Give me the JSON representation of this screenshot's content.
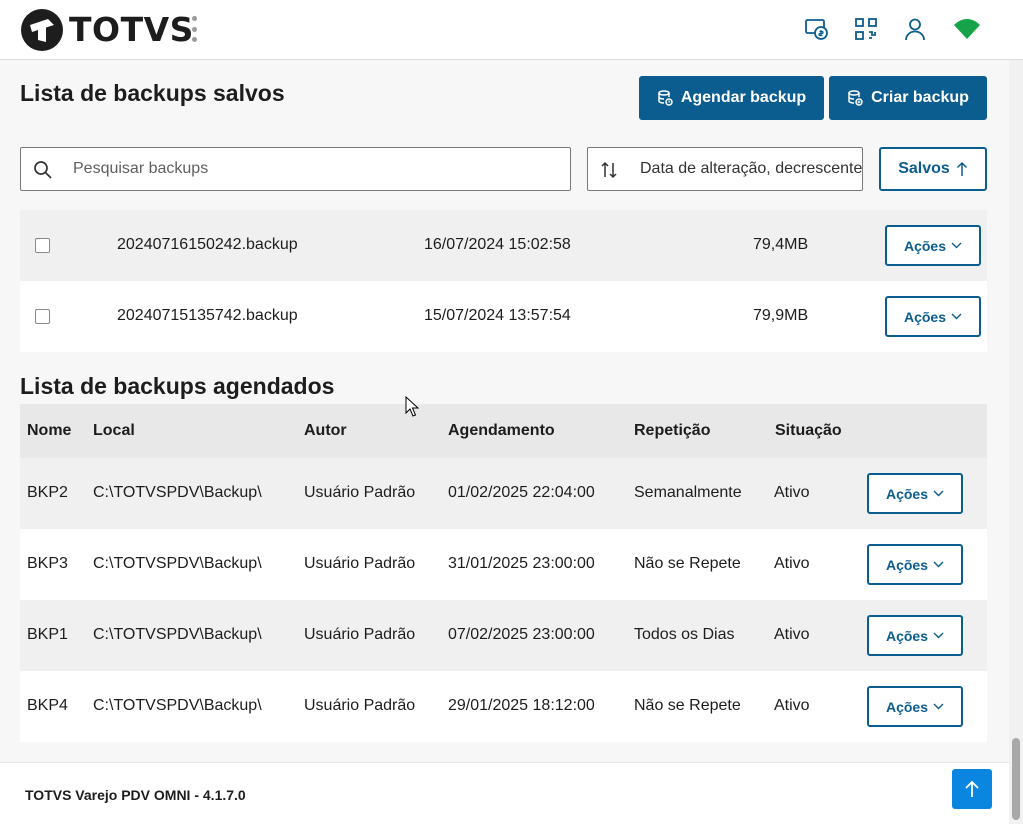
{
  "header": {
    "brand": "TOTVS",
    "icons": [
      "money-receipt-icon",
      "qr-code-icon",
      "user-icon",
      "wifi-icon"
    ],
    "wifi_color": "#16a34a"
  },
  "saved_section": {
    "title": "Lista de backups salvos",
    "schedule_button": "Agendar backup",
    "create_button": "Criar backup",
    "search_placeholder": "Pesquisar backups",
    "sort_label": "Data de alteração, decrescente",
    "filter_button": "Salvos",
    "rows": [
      {
        "name": "20240716150242.backup",
        "date": "16/07/2024 15:02:58",
        "size": "79,4MB",
        "action": "Ações",
        "checked": false
      },
      {
        "name": "20240715135742.backup",
        "date": "15/07/2024 13:57:54",
        "size": "79,9MB",
        "action": "Ações",
        "checked": false
      }
    ]
  },
  "scheduled_section": {
    "title": "Lista de backups agendados",
    "columns": [
      "Nome",
      "Local",
      "Autor",
      "Agendamento",
      "Repetição",
      "Situação"
    ],
    "rows": [
      {
        "nome": "BKP2",
        "local": "C:\\TOTVSPDV\\Backup\\",
        "autor": "Usuário Padrão",
        "agendamento": "01/02/2025 22:04:00",
        "repeticao": "Semanalmente",
        "situacao": "Ativo",
        "action": "Ações"
      },
      {
        "nome": "BKP3",
        "local": "C:\\TOTVSPDV\\Backup\\",
        "autor": "Usuário Padrão",
        "agendamento": "31/01/2025 23:00:00",
        "repeticao": "Não se Repete",
        "situacao": "Ativo",
        "action": "Ações"
      },
      {
        "nome": "BKP1",
        "local": "C:\\TOTVSPDV\\Backup\\",
        "autor": "Usuário Padrão",
        "agendamento": "07/02/2025 23:00:00",
        "repeticao": "Todos os Dias",
        "situacao": "Ativo",
        "action": "Ações"
      },
      {
        "nome": "BKP4",
        "local": "C:\\TOTVSPDV\\Backup\\",
        "autor": "Usuário Padrão",
        "agendamento": "29/01/2025 18:12:00",
        "repeticao": "Não se Repete",
        "situacao": "Ativo",
        "action": "Ações"
      }
    ]
  },
  "footer": {
    "version": "TOTVS Varejo PDV OMNI - 4.1.7.0"
  },
  "colors": {
    "primary": "#0c5d8f",
    "back_to_top": "#0b86e0"
  }
}
